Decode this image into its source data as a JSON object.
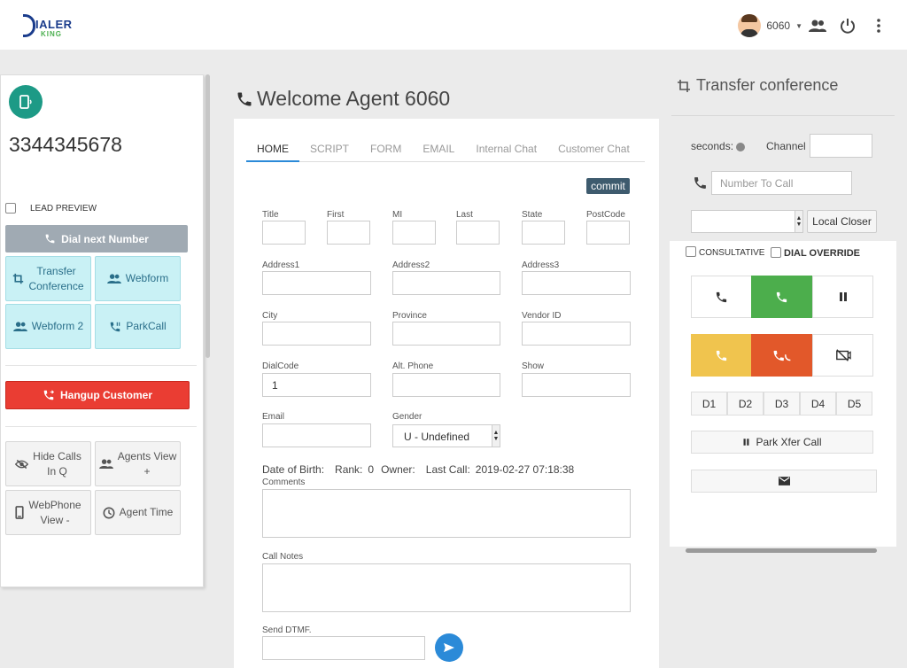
{
  "brand": {
    "logo_main": "IALER",
    "logo_sub": "KING"
  },
  "header": {
    "user_name": "6060"
  },
  "left": {
    "phone_number": "3344345678",
    "lead_preview_label": "LEAD PREVIEW",
    "dial_next_label": "Dial next Number",
    "buttons": [
      {
        "label_line1": "Transfer",
        "label_line2": "Conference"
      },
      {
        "label_line1": "Webform",
        "label_line2": ""
      },
      {
        "label_line1": "Webform 2",
        "label_line2": ""
      },
      {
        "label_line1": "ParkCall",
        "label_line2": ""
      }
    ],
    "hangup_label": "Hangup Customer",
    "utility_buttons": [
      {
        "label_line1": "Hide Calls",
        "label_line2": "In Q"
      },
      {
        "label_line1": "Agents View",
        "label_line2": "+"
      },
      {
        "label_line1": "WebPhone",
        "label_line2": "View -"
      },
      {
        "label_line1": "Agent Time",
        "label_line2": ""
      }
    ]
  },
  "main": {
    "welcome": "Welcome Agent 6060",
    "tabs": [
      "HOME",
      "SCRIPT",
      "FORM",
      "EMAIL",
      "Internal Chat",
      "Customer Chat"
    ],
    "commit_label": "commit",
    "fields": {
      "title": "Title",
      "first": "First",
      "mi": "MI",
      "last": "Last",
      "state": "State",
      "postcode": "PostCode",
      "address1": "Address1",
      "address2": "Address2",
      "address3": "Address3",
      "city": "City",
      "province": "Province",
      "vendor_id": "Vendor ID",
      "dialcode": "DialCode",
      "alt_phone": "Alt. Phone",
      "show": "Show",
      "email": "Email",
      "gender": "Gender"
    },
    "values": {
      "dialcode": "1",
      "gender": "U - Undefined"
    },
    "info": {
      "dob_label": "Date of Birth:",
      "rank_label": "Rank:",
      "rank_value": "0",
      "owner_label": "Owner:",
      "last_call_label": "Last Call:",
      "last_call_value": "2019-02-27 07:18:38"
    },
    "comments_label": "Comments",
    "call_notes_label": "Call Notes",
    "send_dtmf_label": "Send DTMF."
  },
  "transfer": {
    "title": "Transfer conference",
    "seconds_label": "seconds:",
    "channel_label": "Channel :",
    "number_placeholder": "Number To Call",
    "local_closer_label": "Local Closer",
    "consultative_label": "CONSULTATIVE",
    "dial_override_label": "DIAL OVERRIDE",
    "d_buttons": [
      "D1",
      "D2",
      "D3",
      "D4",
      "D5"
    ],
    "park_xfer_label": "Park Xfer Call"
  },
  "colors": {
    "green": "#4cae4c",
    "yellow": "#f0c44e",
    "orange": "#e2582a",
    "red": "#ea3d33",
    "teal": "#1d9a86",
    "blue": "#2b8ad8"
  }
}
